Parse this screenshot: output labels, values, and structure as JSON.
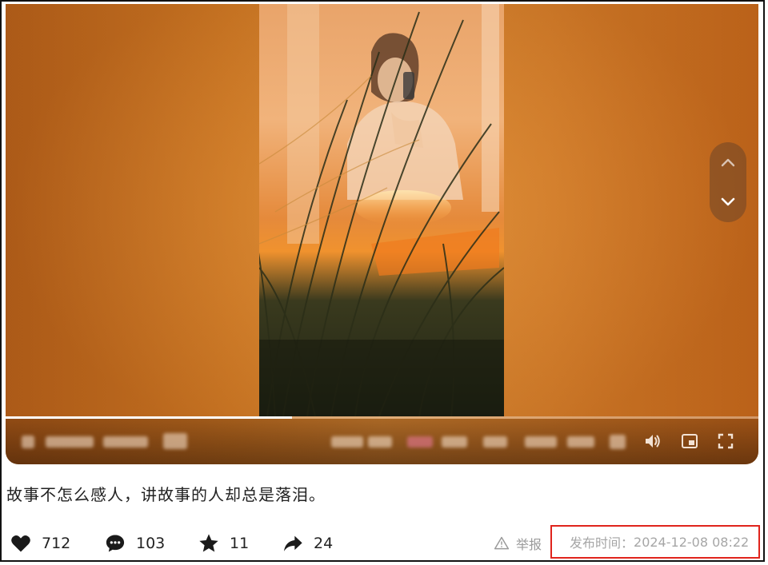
{
  "video": {
    "progress": 0.38,
    "scroll_up_icon": "chevron-up-icon",
    "scroll_down_icon": "chevron-down-icon",
    "control_icons": [
      "volume-icon",
      "picture-in-picture-icon",
      "fullscreen-icon"
    ]
  },
  "post": {
    "caption": "故事不怎么感人，讲故事的人却总是落泪。"
  },
  "stats": {
    "likes": "712",
    "comments": "103",
    "favorites": "11",
    "shares": "24"
  },
  "meta": {
    "report_label": "举报",
    "publish_label": "发布时间：",
    "publish_time": "2024-12-08 08:22"
  },
  "colors": {
    "highlight_box": "#e0241c",
    "muted_text": "#a6a6a6"
  }
}
